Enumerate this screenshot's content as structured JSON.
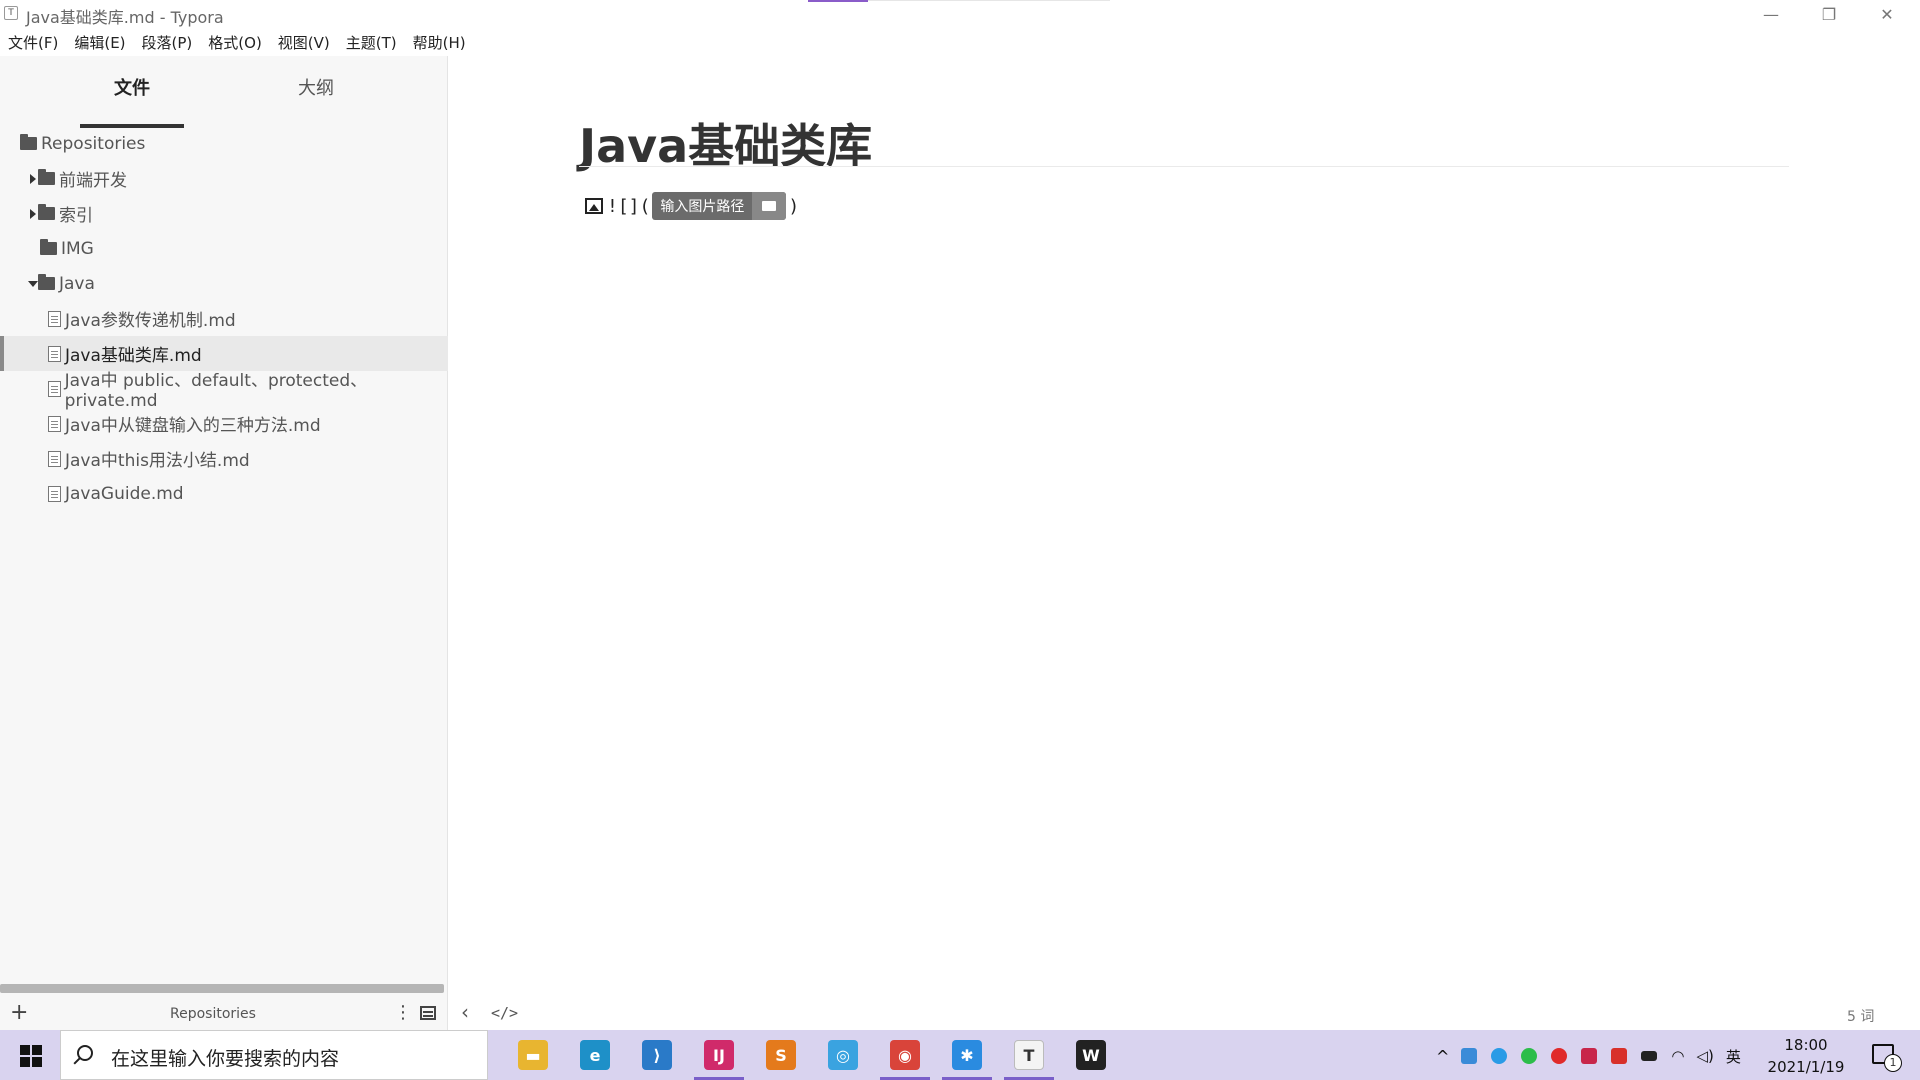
{
  "window": {
    "app_icon": "T",
    "title": "Java基础类库.md - Typora",
    "minimize": "—",
    "restore": "❐",
    "close": "✕"
  },
  "menu": [
    "文件(F)",
    "编辑(E)",
    "段落(P)",
    "格式(O)",
    "视图(V)",
    "主题(T)",
    "帮助(H)"
  ],
  "sidebar": {
    "tabs": [
      {
        "label": "文件",
        "active": true
      },
      {
        "label": "大纲",
        "active": false
      }
    ],
    "tree": [
      {
        "label": "Repositories",
        "type": "folder",
        "arrow": "none",
        "selected": false
      },
      {
        "label": "前端开发",
        "type": "folder",
        "arrow": "right",
        "selected": false
      },
      {
        "label": "索引",
        "type": "folder",
        "arrow": "right",
        "selected": false
      },
      {
        "label": "IMG",
        "type": "folder",
        "arrow": "none",
        "selected": false
      },
      {
        "label": "Java",
        "type": "folder",
        "arrow": "down",
        "selected": false
      },
      {
        "label": "Java参数传递机制.md",
        "type": "file",
        "selected": false
      },
      {
        "label": "Java基础类库.md",
        "type": "file",
        "selected": true
      },
      {
        "label": "Java中 public、default、protected、private.md",
        "type": "file",
        "selected": false
      },
      {
        "label": "Java中从键盘输入的三种方法.md",
        "type": "file",
        "selected": false
      },
      {
        "label": "Java中this用法小结.md",
        "type": "file",
        "selected": false
      },
      {
        "label": "JavaGuide.md",
        "type": "file",
        "selected": false
      }
    ],
    "footer": {
      "add": "+",
      "repo_name": "Repositories",
      "more": "⋮"
    }
  },
  "editor": {
    "heading": "Java基础类库",
    "img_syntax_prefix": "![](",
    "img_syntax_suffix": ")",
    "img_tooltip": "输入图片路径",
    "footer": {
      "back": "‹",
      "source": "</>",
      "word_count": "5 词"
    }
  },
  "taskbar": {
    "search_placeholder": "在这里输入你要搜索的内容",
    "apps": [
      {
        "name": "file-explorer",
        "glyph": "▬",
        "color": "#e8b530",
        "running": false
      },
      {
        "name": "edge",
        "glyph": "e",
        "color": "#1e90c8",
        "running": false
      },
      {
        "name": "vscode",
        "glyph": "⟩",
        "color": "#2a7ac8",
        "running": false
      },
      {
        "name": "intellij",
        "glyph": "IJ",
        "color": "#d02a6a",
        "running": true
      },
      {
        "name": "sublime",
        "glyph": "S",
        "color": "#e47a1c",
        "running": false
      },
      {
        "name": "app-ring",
        "glyph": "◎",
        "color": "#3aa3e0",
        "running": false
      },
      {
        "name": "chrome",
        "glyph": "◉",
        "color": "#d9443a",
        "running": true
      },
      {
        "name": "app-star",
        "glyph": "✱",
        "color": "#2a8be0",
        "running": true
      },
      {
        "name": "typora",
        "glyph": "T",
        "color": "#f4f4f4",
        "running": true
      },
      {
        "name": "wps",
        "glyph": "W",
        "color": "#222222",
        "running": false
      }
    ],
    "tray_caret": "^",
    "ime": "英",
    "time": "18:00",
    "date": "2021/1/19",
    "notification_count": "1"
  }
}
